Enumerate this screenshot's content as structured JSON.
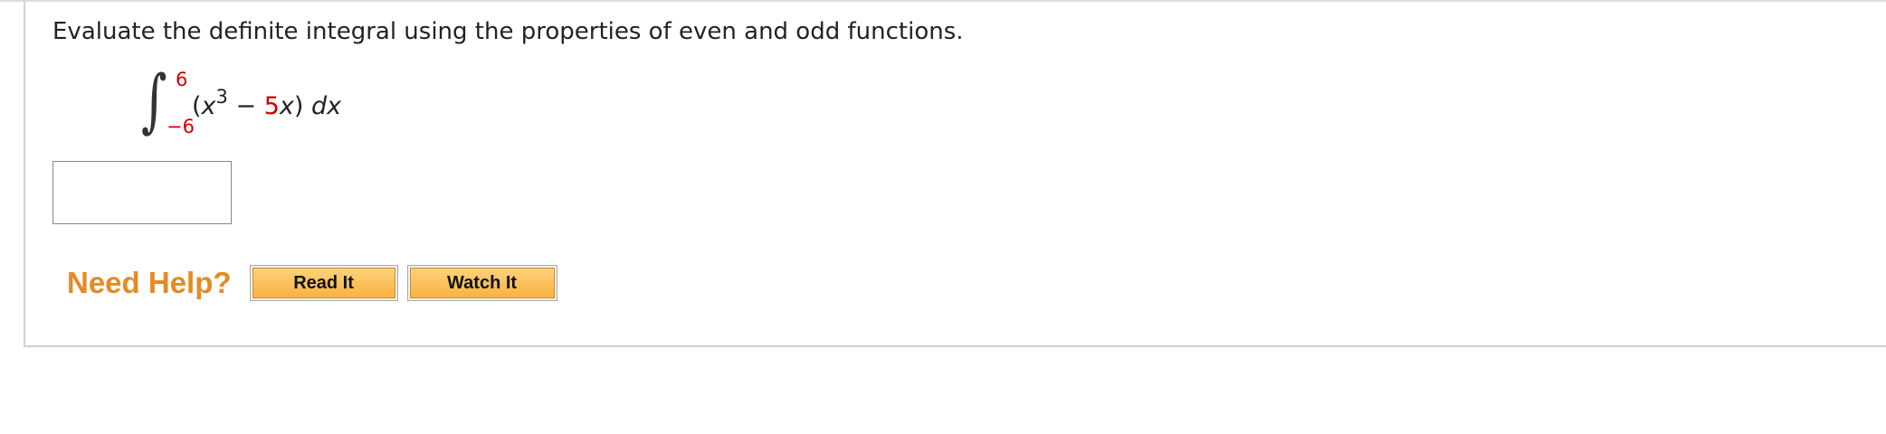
{
  "question": {
    "prompt": "Evaluate the definite integral using the properties of even and odd functions.",
    "integral": {
      "sign": "∫",
      "upper_limit": "6",
      "lower_limit": "−6",
      "open_paren": "(",
      "x1": "x",
      "exponent": "3",
      "minus": " − ",
      "coefficient": "5",
      "x2": "x",
      "close_paren": ")",
      "differential": " dx"
    },
    "answer": {
      "value": "",
      "placeholder": ""
    }
  },
  "help": {
    "label": "Need Help?",
    "read_it": "Read It",
    "watch_it": "Watch It"
  },
  "colors": {
    "accent_orange": "#e58a26",
    "limit_red": "#cc0000",
    "button_fill": "#f7b341"
  }
}
